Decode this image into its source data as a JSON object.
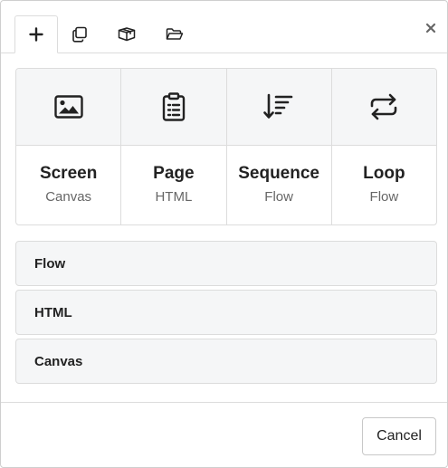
{
  "tabs": [
    {
      "icon": "plus-icon",
      "active": true
    },
    {
      "icon": "copy-icon",
      "active": false
    },
    {
      "icon": "package-icon",
      "active": false
    },
    {
      "icon": "folder-open-icon",
      "active": false
    }
  ],
  "close_label": "×",
  "cards": [
    {
      "icon": "image-icon",
      "title": "Screen",
      "subtitle": "Canvas"
    },
    {
      "icon": "clipboard-icon",
      "title": "Page",
      "subtitle": "HTML"
    },
    {
      "icon": "sort-descending-icon",
      "title": "Sequence",
      "subtitle": "Flow"
    },
    {
      "icon": "repeat-icon",
      "title": "Loop",
      "subtitle": "Flow"
    }
  ],
  "list": [
    {
      "label": "Flow"
    },
    {
      "label": "HTML"
    },
    {
      "label": "Canvas"
    }
  ],
  "footer": {
    "cancel_label": "Cancel"
  },
  "colors": {
    "panel_bg": "#f5f6f7",
    "border": "#dcdcdc",
    "text": "#222222",
    "muted": "#666666"
  }
}
